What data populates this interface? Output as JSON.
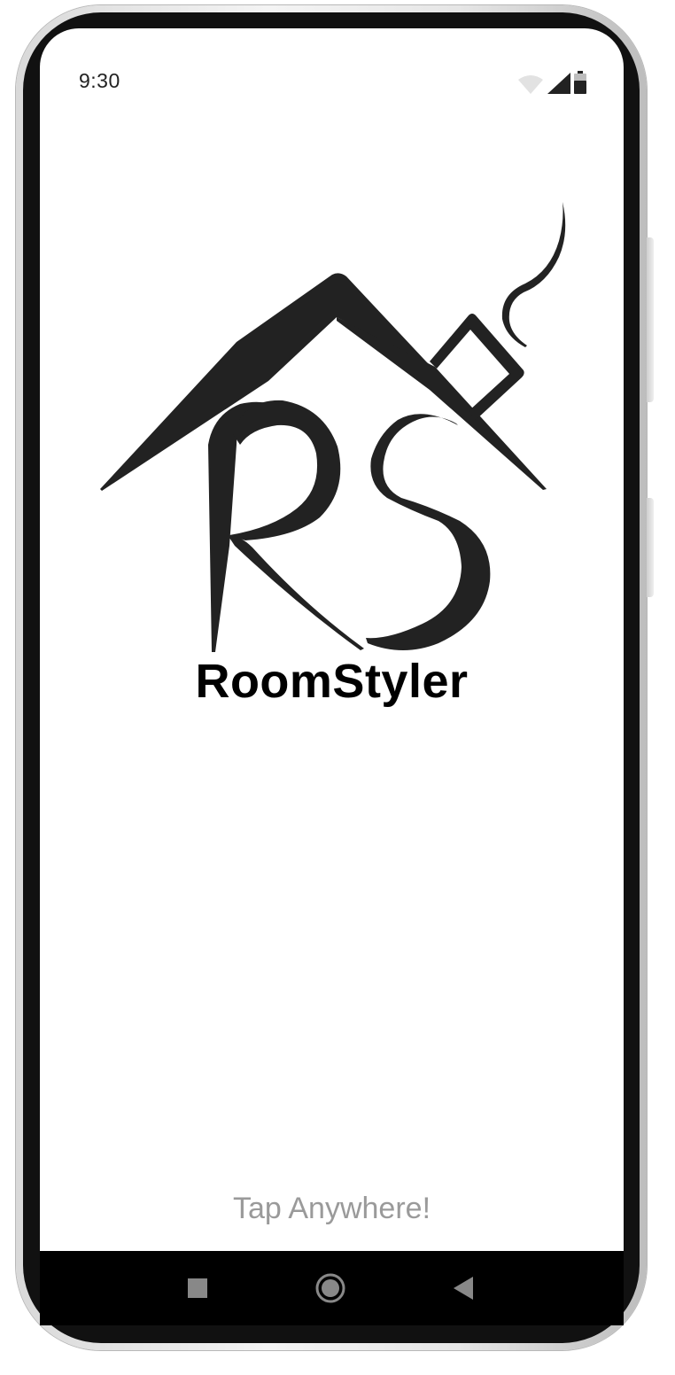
{
  "status_bar": {
    "time": "9:30",
    "icons": [
      "wifi-icon",
      "cellular-signal-icon",
      "battery-icon"
    ]
  },
  "splash": {
    "logo_icon": "house-rs-logo-icon",
    "brand_name": "RoomStyler",
    "hint": "Tap Anywhere!"
  },
  "nav_bar": {
    "buttons": [
      "recents-square-icon",
      "home-circle-icon",
      "back-triangle-icon"
    ]
  },
  "colors": {
    "logo": "#222222",
    "brand_text": "#000000",
    "hint_text": "#9a9a9a",
    "nav_bar": "#000000",
    "nav_icons": "#888888"
  }
}
